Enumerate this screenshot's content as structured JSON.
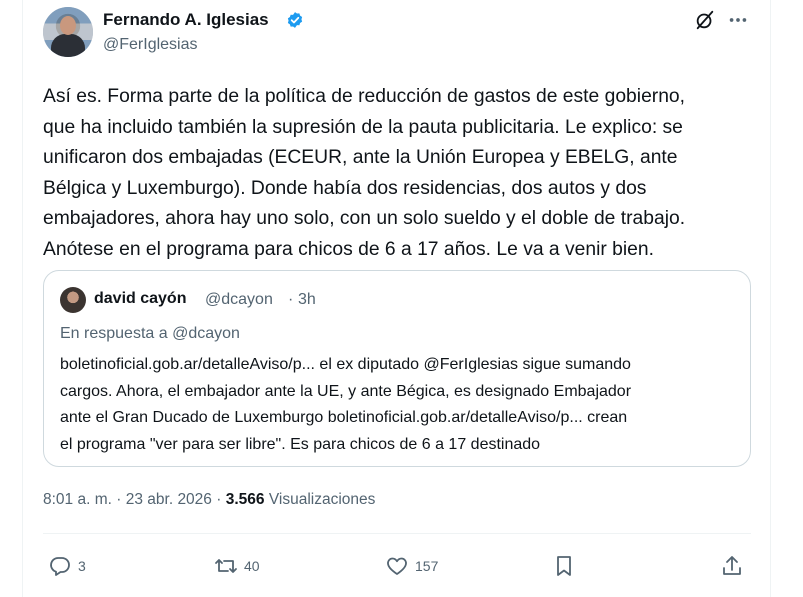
{
  "author": {
    "display_name": "Fernando A. Iglesias",
    "handle": "@FerIglesias",
    "verified_color": "#1d9bf0"
  },
  "tweet": {
    "lines": [
      "Así es. Forma parte de la política de reducción de gastos de este gobierno,",
      "que ha incluido también la supresión de la pauta publicitaria. Le explico: se",
      "unificaron dos embajadas (ECEUR, ante la Unión Europea y EBELG, ante",
      "Bélgica y Luxemburgo). Donde había dos residencias, dos autos y dos",
      "embajadores, ahora hay uno solo, con un solo sueldo y el doble de trabajo.",
      "Anótese en el programa para chicos de 6 a 17 años. Le va a venir bien."
    ]
  },
  "quote": {
    "name": "david cayón",
    "handle": "@dcayon",
    "separator": "·",
    "time": "3h",
    "reply_to": "En respuesta a @dcayon",
    "lines": [
      "boletinoficial.gob.ar/detalleAviso/p... el ex diputado @FerIglesias sigue sumando",
      "cargos. Ahora, el embajador ante la UE, y ante Bégica, es designado Embajador",
      "ante el Gran Ducado de Luxemburgo boletinoficial.gob.ar/detalleAviso/p... crean",
      "el programa \"ver para ser libre\". Es para chicos de 6 a 17 destinado"
    ]
  },
  "meta": {
    "time": "8:01 a. m.",
    "sep1": "·",
    "date": "23 abr. 2026",
    "sep2": "·",
    "views_count": "3.566",
    "views_label": "Visualizaciones"
  },
  "actions": {
    "reply_count": "3",
    "retweet_count": "40",
    "like_count": "157"
  },
  "icons": {
    "grok": "grok-icon",
    "more": "more-icon",
    "reply": "reply-icon",
    "retweet": "retweet-icon",
    "like": "heart-icon",
    "bookmark": "bookmark-icon",
    "share": "share-icon"
  }
}
